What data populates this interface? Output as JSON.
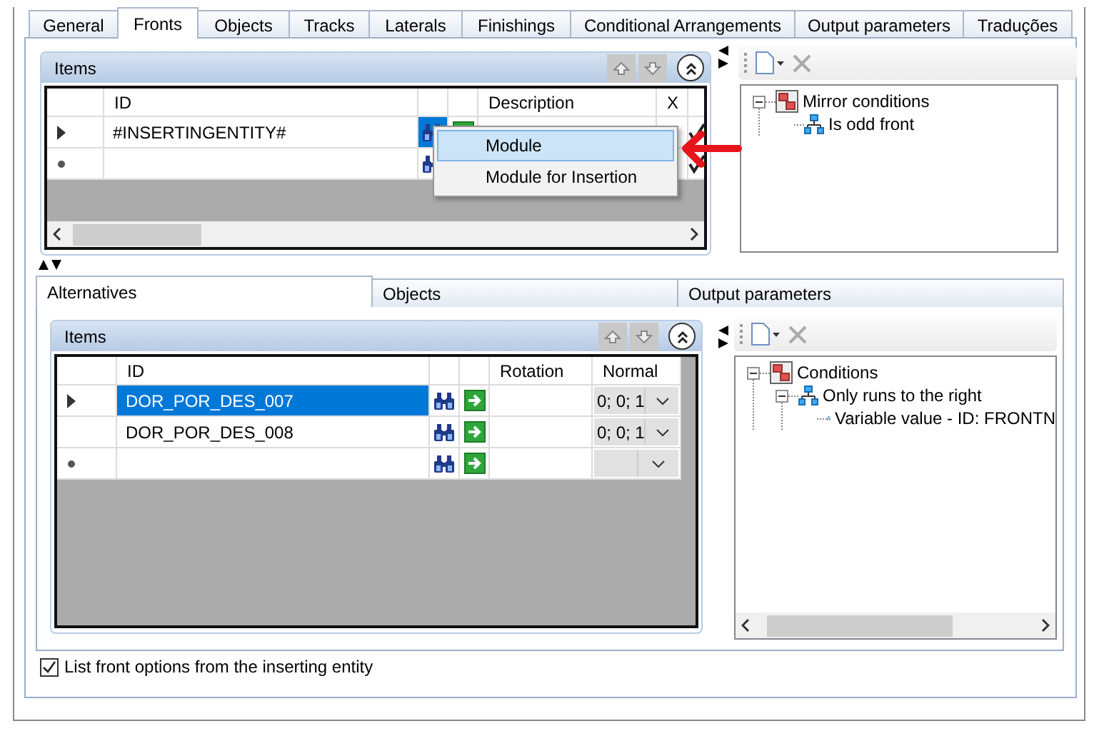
{
  "tabs": [
    {
      "label": "General",
      "selected": false
    },
    {
      "label": "Fronts",
      "selected": true
    },
    {
      "label": "Objects",
      "selected": false
    },
    {
      "label": "Tracks",
      "selected": false
    },
    {
      "label": "Laterals",
      "selected": false
    },
    {
      "label": "Finishings",
      "selected": false
    },
    {
      "label": "Conditional Arrangements",
      "selected": false
    },
    {
      "label": "Output parameters",
      "selected": false
    },
    {
      "label": "Traduções",
      "selected": false
    }
  ],
  "fronts_items": {
    "title": "Items",
    "columns": [
      {
        "kind": "text",
        "label": "ID"
      },
      {
        "kind": "find"
      },
      {
        "kind": "go"
      },
      {
        "kind": "text",
        "label": "Description"
      },
      {
        "kind": "text",
        "label": "X"
      },
      {
        "kind": "check"
      }
    ],
    "rows": [
      {
        "kind": "current",
        "selected": false,
        "find_pressed": true,
        "cells": [
          "#INSERTINGENTITY#",
          null,
          null,
          null,
          null,
          null
        ]
      },
      {
        "kind": "new",
        "selected": false,
        "find_pressed": false,
        "cells": [
          null,
          null,
          null,
          null,
          null,
          null
        ]
      }
    ]
  },
  "insert_menu": [
    {
      "label": "Module",
      "selected": true
    },
    {
      "label": "Module for Insertion",
      "selected": false
    }
  ],
  "mirror_tree": [
    {
      "label": "Mirror conditions",
      "kind": "group",
      "expanded": true,
      "children": [
        {
          "label": "Is odd front",
          "kind": "condition"
        }
      ]
    }
  ],
  "sub_tabs": [
    {
      "label": "Alternatives",
      "selected": true
    },
    {
      "label": "Objects",
      "selected": false
    },
    {
      "label": "Output parameters",
      "selected": false
    }
  ],
  "alternatives_items": {
    "title": "Items",
    "columns": [
      {
        "kind": "text",
        "label": "ID"
      },
      {
        "kind": "find"
      },
      {
        "kind": "go"
      },
      {
        "kind": "text",
        "label": "Rotation"
      },
      {
        "kind": "combo",
        "label": "Normal"
      }
    ],
    "rows": [
      {
        "kind": "current",
        "selected": true,
        "find_pressed": false,
        "cells": [
          "DOR_POR_DES_007",
          null,
          null,
          null,
          "0; 0; 1"
        ]
      },
      {
        "kind": "plain",
        "selected": false,
        "find_pressed": false,
        "cells": [
          "DOR_POR_DES_008",
          null,
          null,
          null,
          "0; 0; 1"
        ]
      },
      {
        "kind": "new",
        "selected": false,
        "find_pressed": false,
        "cells": [
          null,
          null,
          null,
          null,
          null
        ]
      }
    ]
  },
  "conditions_tree": [
    {
      "label": "Conditions",
      "kind": "group",
      "expanded": true,
      "children": [
        {
          "label": "Only runs to the right",
          "kind": "condition",
          "expanded": true,
          "children": [
            {
              "label": "Variable value - ID: FRONTN",
              "kind": "condition"
            }
          ]
        }
      ]
    }
  ],
  "list_options_checkbox": {
    "label": "List front options from the inserting entity",
    "checked": true
  }
}
